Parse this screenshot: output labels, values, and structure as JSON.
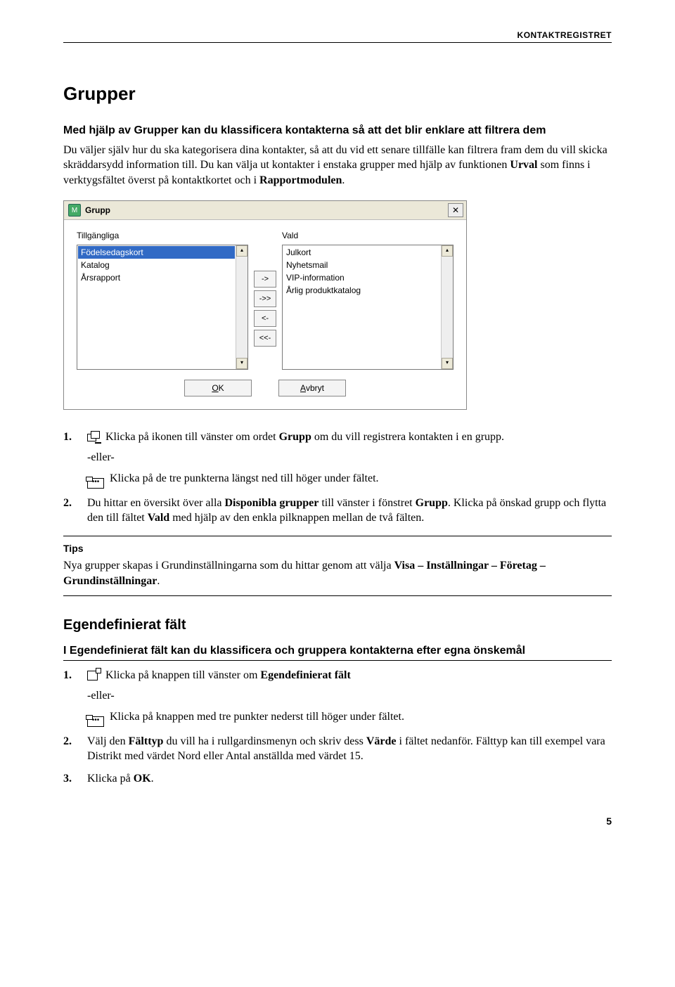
{
  "header": {
    "label": "KONTAKTREGISTRET"
  },
  "title": "Grupper",
  "lead": "Med hjälp av Grupper kan du klassificera kontakterna så att det blir enklare att filtrera dem",
  "intro_part1": "Du väljer själv hur du ska kategorisera dina kontakter, så att du vid ett senare tillfälle kan filtrera fram dem du vill skicka skräddarsydd information till. Du kan välja ut kontakter i enstaka grupper med hjälp av funktionen ",
  "intro_bold_urval": "Urval",
  "intro_part2": " som finns i verktygsfältet överst på kontaktkortet och i ",
  "intro_bold_rapport": "Rapportmodulen",
  "dialog": {
    "title": "Grupp",
    "app_icon_letter": "M",
    "left_label": "Tillgängliga",
    "right_label": "Vald",
    "left_items": [
      "Födelsedagskort",
      "Katalog",
      "Årsrapport"
    ],
    "right_items": [
      "Julkort",
      "Nyhetsmail",
      "VIP-information",
      "Årlig produktkatalog"
    ],
    "mover_btns": [
      "->",
      "->>",
      "<-",
      "<<-"
    ],
    "ok_prefix": "O",
    "ok_rest": "K",
    "cancel_prefix": "A",
    "cancel_rest": "vbryt",
    "scroll_up": "▴",
    "scroll_down": "▾"
  },
  "steps1": {
    "n1": "1.",
    "s1a": " Klicka på ikonen till vänster om ordet ",
    "s1b_bold": "Grupp",
    "s1c": " om du vill registrera kontakten i en grupp.",
    "eller": "-eller-",
    "s1d": " Klicka på de tre punkterna längst ned till höger under fältet.",
    "n2": "2.",
    "s2a": "Du hittar en översikt över alla ",
    "s2b_bold": "Disponibla grupper",
    "s2c": " till vänster i fönstret ",
    "s2d_bold": "Grupp",
    "s2e": ". Klicka på önskad grupp och flytta den till fältet ",
    "s2f_bold": "Vald",
    "s2g": " med hjälp av den enkla pilknappen mellan de två fälten."
  },
  "tips": {
    "title": "Tips",
    "body_a": "Nya grupper skapas i Grundinställningarna som du hittar genom att välja ",
    "body_b_bold": "Visa – Inställningar – Företag – Grundinställningar",
    "body_c": "."
  },
  "section2": {
    "title": "Egendefinierat fält",
    "lead": "I Egendefinierat fält kan du klassificera och gruppera kontakterna efter egna önskemål"
  },
  "steps2": {
    "n1": "1.",
    "s1a": " Klicka på knappen till vänster om ",
    "s1b_bold": "Egendefinierat fält",
    "eller": "-eller-",
    "s1c": " Klicka på knappen med tre punkter nederst till höger under fältet.",
    "n2": "2.",
    "s2a": "Välj den ",
    "s2b_bold": "Fälttyp",
    "s2c": " du vill ha i rullgardinsmenyn och skriv dess ",
    "s2d_bold": "Värde",
    "s2e": " i fältet nedanför. Fälttyp kan till exempel vara Distrikt med värdet Nord eller Antal anställda med värdet 15.",
    "n3": "3.",
    "s3a": "Klicka på ",
    "s3b_bold": "OK",
    "s3c": "."
  },
  "page_number": "5"
}
